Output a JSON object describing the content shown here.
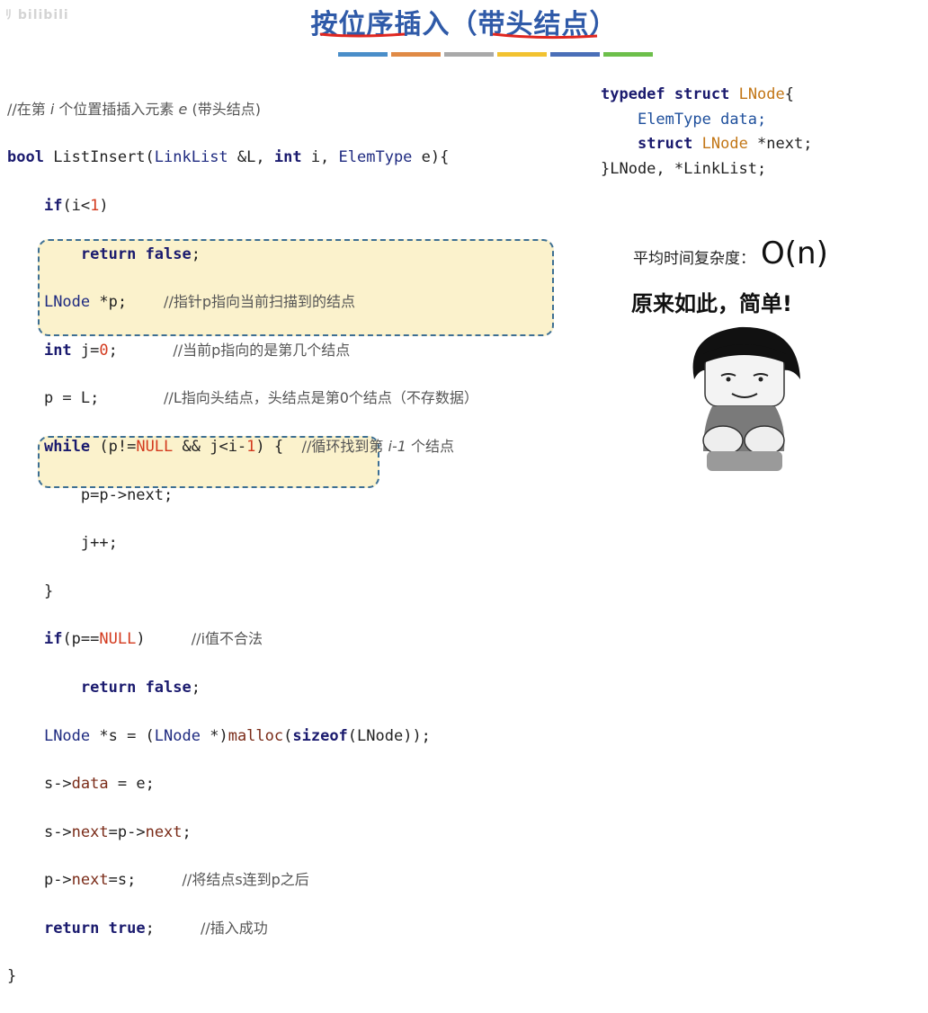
{
  "watermark": "ﾘ bilibili",
  "title": "按位序插入（带头结点）",
  "color_bar": [
    "#4a8ec9",
    "#e08a45",
    "#a9a9a9",
    "#f2c230",
    "#4a6fb8",
    "#6dbf4b"
  ],
  "code": {
    "comment_header_a": "//在第 ",
    "comment_header_i": "i",
    "comment_header_b": " 个位置插插入元素 ",
    "comment_header_e": "e",
    "comment_header_c": " (带头结点)",
    "kw_bool": "bool",
    "fn_name": " ListInsert(",
    "ty_linklist": "LinkList",
    "params_a": " &L, ",
    "kw_int": "int",
    "params_b": " i, ",
    "ty_elemtype": "ElemType",
    "params_c": " e){",
    "kw_if": "if",
    "cond_a": "(i<",
    "num_1": "1",
    "cond_b": ")",
    "kw_return": "return",
    "kw_false": "false",
    "semi": ";",
    "ty_lnode": "LNode",
    "decl_p": " *p;",
    "cm_p": "//指针p指向当前扫描到的结点",
    "decl_j_a": " j=",
    "num_0": "0",
    "cm_j": "//当前p指向的是第几个结点",
    "assign_p": "p = L;",
    "cm_l": "//L指向头结点，头结点是第0个结点（不存数据）",
    "kw_while": "while",
    "while_a": " (p!=",
    "kw_null": "NULL",
    "while_b": " && j<i-",
    "while_c": ") {",
    "cm_while_a": "//循环找到第 ",
    "cm_while_i": "i-1",
    "cm_while_b": " 个结点",
    "p_next": "p=p->next;",
    "j_inc": "j++;",
    "close_brace": "}",
    "if2_a": "(p==",
    "if2_b": ")",
    "cm_illegal": "//i值不合法",
    "decl_s_a": " *s = (",
    "decl_s_b": " *)",
    "fn_malloc": "malloc",
    "decl_s_c": "(",
    "kw_sizeof": "sizeof",
    "decl_s_d": "(LNode));",
    "s_data_a": "s->",
    "s_data_field": "data",
    "s_data_b": " = e;",
    "s_next_a": "s->",
    "s_next_field": "next",
    "s_next_b": "=p->",
    "s_next_c": "next",
    "s_next_d": ";",
    "p_next2_a": "p->",
    "p_next2_field": "next",
    "p_next2_b": "=s;",
    "cm_link": "//将结点s连到p之后",
    "kw_true": "true",
    "cm_success": "//插入成功",
    "final_brace": "}"
  },
  "struct_def": {
    "kw_typedef": "typedef",
    "kw_struct": "struct",
    "name": "LNode",
    "open": "{",
    "ty_elemtype": "ElemType",
    "field_data": " data;",
    "field_next_a": " *next;",
    "close": "}LNode, *LinkList;"
  },
  "complexity": {
    "label": "平均时间复杂度：",
    "value": "O(n)"
  },
  "meme_caption": "原来如此，简单!"
}
